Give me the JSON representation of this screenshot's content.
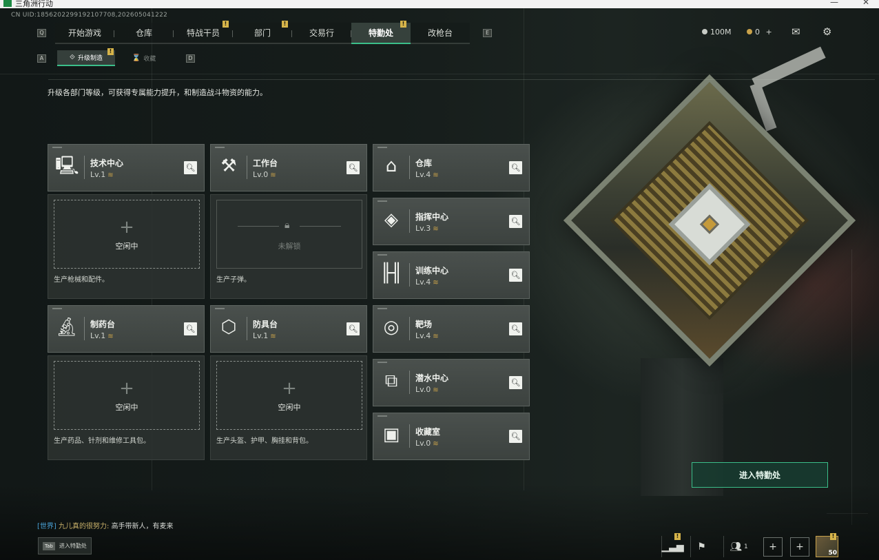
{
  "window": {
    "title": "三角洲行动",
    "controls": [
      "—",
      "□",
      "✕"
    ]
  },
  "uid_text": "CN UID:1856202299192107708,202605041222",
  "nav": {
    "key_left": "Q",
    "key_right": "E",
    "tabs": [
      {
        "label": "开始游戏",
        "badge": ""
      },
      {
        "label": "仓库",
        "badge": ""
      },
      {
        "label": "特战干员",
        "badge": "!"
      },
      {
        "label": "部门",
        "badge": "!"
      },
      {
        "label": "交易行",
        "badge": ""
      },
      {
        "label": "特勤处",
        "badge": "!",
        "active": true
      },
      {
        "label": "改枪台",
        "badge": ""
      }
    ]
  },
  "subnav": {
    "key_left": "A",
    "key_right": "D",
    "tabs": [
      {
        "label": "升级制造",
        "icon": "⟐",
        "badge": "!",
        "active": true
      },
      {
        "label": "收藏",
        "icon": "⌛",
        "badge": ""
      }
    ]
  },
  "description": "升级各部门等级，可获得专属能力提升，和制造战斗物资的能力。",
  "currency": {
    "silver": "100M",
    "gold": "0",
    "plus": "+",
    "mail_icon": "envelope-icon",
    "settings_icon": "gear-icon"
  },
  "production_facilities": [
    {
      "name": "技术中心",
      "level": "Lv.1",
      "icon": "computer-icon",
      "slot_status": "空闲中",
      "locked": false,
      "note": "生产枪械和配件。"
    },
    {
      "name": "工作台",
      "level": "Lv.0",
      "icon": "tools-icon",
      "slot_status": "未解锁",
      "locked": true,
      "note": "生产子弹。"
    },
    {
      "name": "制药台",
      "level": "Lv.1",
      "icon": "microscope-icon",
      "slot_status": "空闲中",
      "locked": false,
      "note": "生产药品、针剂和维修工具包。"
    },
    {
      "name": "防具台",
      "level": "Lv.1",
      "icon": "armor-icon",
      "slot_status": "空闲中",
      "locked": false,
      "note": "生产头盔、护甲、胸挂和背包。"
    }
  ],
  "facilities": [
    {
      "name": "仓库",
      "level": "Lv.4",
      "icon": "warehouse-icon"
    },
    {
      "name": "指挥中心",
      "level": "Lv.3",
      "icon": "command-icon"
    },
    {
      "name": "训练中心",
      "level": "Lv.4",
      "icon": "dumbbell-icon"
    },
    {
      "name": "靶场",
      "level": "Lv.4",
      "icon": "target-icon"
    },
    {
      "name": "潜水中心",
      "level": "Lv.0",
      "icon": "diving-mask-icon"
    },
    {
      "name": "收藏室",
      "level": "Lv.0",
      "icon": "collection-icon"
    }
  ],
  "enter_button": "进入特勤处",
  "chat": {
    "channel": "[世界]",
    "user": "九儿真的很努力:",
    "message": "高手带新人，有麦来"
  },
  "tab_hint": {
    "key": "Tab",
    "label": "进入特勤处"
  },
  "bottom_bar": {
    "friends_count": "1",
    "player_level": "50",
    "badge": "!"
  }
}
